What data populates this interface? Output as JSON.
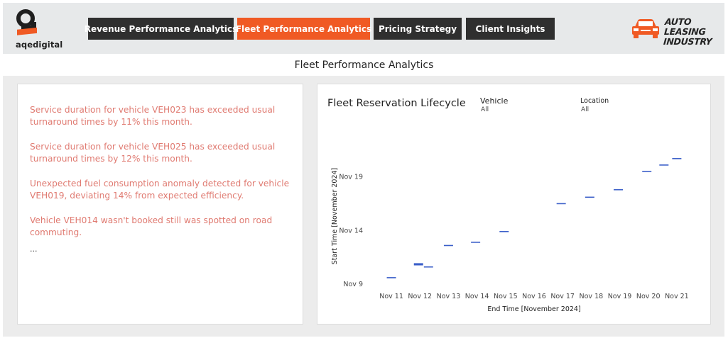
{
  "header": {
    "logo_text": "aqedigital",
    "tabs": [
      {
        "label": "Revenue Performance Analytics",
        "active": false
      },
      {
        "label": "Fleet Performance Analytics",
        "active": true
      },
      {
        "label": "Pricing Strategy",
        "active": false
      },
      {
        "label": "Client Insights",
        "active": false
      }
    ],
    "brand_line1": "AUTO LEASING",
    "brand_line2": "INDUSTRY",
    "accent_color": "#f05a24",
    "tab_color": "#2f2f2f"
  },
  "page_title": "Fleet Performance Analytics",
  "insights": [
    "Service duration for vehicle VEH023 has exceeded usual turnaround times by 11% this month.",
    "Service duration for vehicle VEH025 has exceeded usual turnaround times by 12% this month.",
    "Unexpected fuel consumption anomaly detected for vehicle VEH019, deviating 14% from expected efficiency.",
    "Vehicle VEH014 wasn't booked still was spotted on road commuting.",
    "..."
  ],
  "insight_color": "#e07b72",
  "chart": {
    "title": "Fleet Reservation Lifecycle",
    "filters": [
      {
        "label": "Vehicle",
        "value": "All"
      },
      {
        "label": "Location",
        "value": "All"
      }
    ]
  },
  "chart_data": {
    "type": "scatter",
    "title": "Fleet Reservation Lifecycle",
    "xlabel": "End Time [November 2024]",
    "ylabel": "Start Time [November 2024]",
    "x_ticks": [
      "Nov 11",
      "Nov 12",
      "Nov 13",
      "Nov 14",
      "Nov 15",
      "Nov 16",
      "Nov 17",
      "Nov 18",
      "Nov 19",
      "Nov 20",
      "Nov 21"
    ],
    "y_ticks": [
      {
        "label": "Nov 9",
        "value": 9
      },
      {
        "label": "Nov 14",
        "value": 14
      },
      {
        "label": "Nov 19",
        "value": 19
      }
    ],
    "xlim": [
      10.6,
      21.6
    ],
    "ylim": [
      8.8,
      23.0
    ],
    "marker_color": "#3b5fc9",
    "points": [
      {
        "x": 11.0,
        "y": 9.6
      },
      {
        "x": 11.95,
        "y": 10.8
      },
      {
        "x": 11.95,
        "y": 10.9
      },
      {
        "x": 12.3,
        "y": 10.6
      },
      {
        "x": 13.0,
        "y": 12.6
      },
      {
        "x": 13.95,
        "y": 12.9
      },
      {
        "x": 14.95,
        "y": 13.9
      },
      {
        "x": 16.95,
        "y": 16.5
      },
      {
        "x": 17.95,
        "y": 17.1
      },
      {
        "x": 18.95,
        "y": 17.8
      },
      {
        "x": 19.95,
        "y": 19.5
      },
      {
        "x": 20.55,
        "y": 20.1
      },
      {
        "x": 21.0,
        "y": 20.7
      }
    ]
  }
}
